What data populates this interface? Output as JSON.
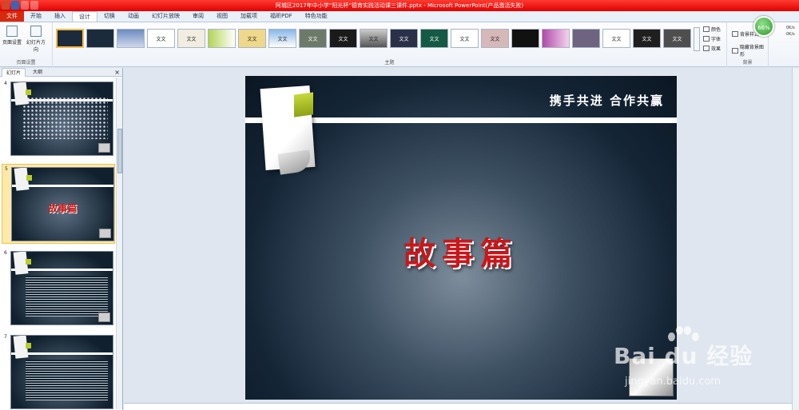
{
  "window": {
    "title": "阿城区2017年中小学“阳光杯”德育实践活动课三课件.pptx - Microsoft PowerPoint(产品激活失败)"
  },
  "menu": {
    "tabs": [
      "文件",
      "开始",
      "插入",
      "设计",
      "切换",
      "动画",
      "幻灯片放映",
      "审阅",
      "视图",
      "加载项",
      "福昕PDF",
      "特色功能"
    ],
    "active": "设计"
  },
  "ribbon": {
    "page_setup": {
      "buttons": [
        "页面设置",
        "幻灯片方向"
      ],
      "group_label": "页面设置"
    },
    "themes": {
      "group_label": "主题",
      "thumb_text": "文文"
    },
    "theme_options": [
      "颜色",
      "字体",
      "效果"
    ],
    "background": {
      "style": "背景样式",
      "hide": "隐藏背景图形",
      "group_label": "背景"
    },
    "badge": "66%",
    "net": [
      "0K/s",
      "0K/s"
    ]
  },
  "panel": {
    "tabs": [
      "幻灯片",
      "大纲"
    ],
    "close": "×",
    "slides": [
      {
        "number": "4"
      },
      {
        "number": "5",
        "title": "故事篇"
      },
      {
        "number": "6"
      },
      {
        "number": "7"
      }
    ]
  },
  "slide": {
    "header": "携手共进 合作共赢",
    "title": "故事篇"
  },
  "watermark": {
    "brand": "Bai du 经验",
    "url": "jingyan.baidu.com"
  }
}
